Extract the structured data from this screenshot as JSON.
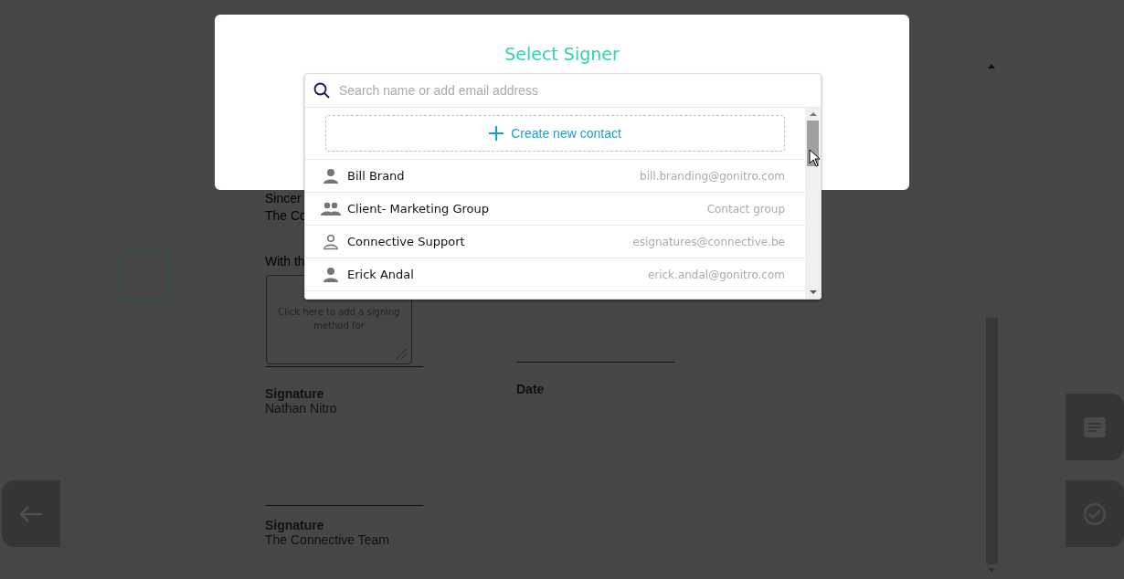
{
  "document": {
    "lines": [
      "Sincer",
      "The Co",
      "With th"
    ],
    "signature_field": {
      "text": "Click here to add a signing method for"
    },
    "signature_blocks": [
      {
        "label": "Signature",
        "name": "Nathan Nitro"
      },
      {
        "label": "Date"
      }
    ],
    "second_block": {
      "label": "Signature",
      "name": "The Connective Team"
    }
  },
  "dialog": {
    "title": "Select Signer",
    "search": {
      "placeholder": "Search name or add email address"
    },
    "create_button": {
      "label": "Create new contact"
    },
    "contacts": [
      {
        "kind": "person",
        "name": "Bill Brand",
        "detail": "bill.branding@gonitro.com"
      },
      {
        "kind": "group",
        "name": "Client- Marketing Group",
        "detail": "Contact group"
      },
      {
        "kind": "support",
        "name": "Connective Support",
        "detail": "esignatures@connective.be"
      },
      {
        "kind": "person",
        "name": "Erick Andal",
        "detail": "erick.andal@gonitro.com"
      }
    ]
  }
}
